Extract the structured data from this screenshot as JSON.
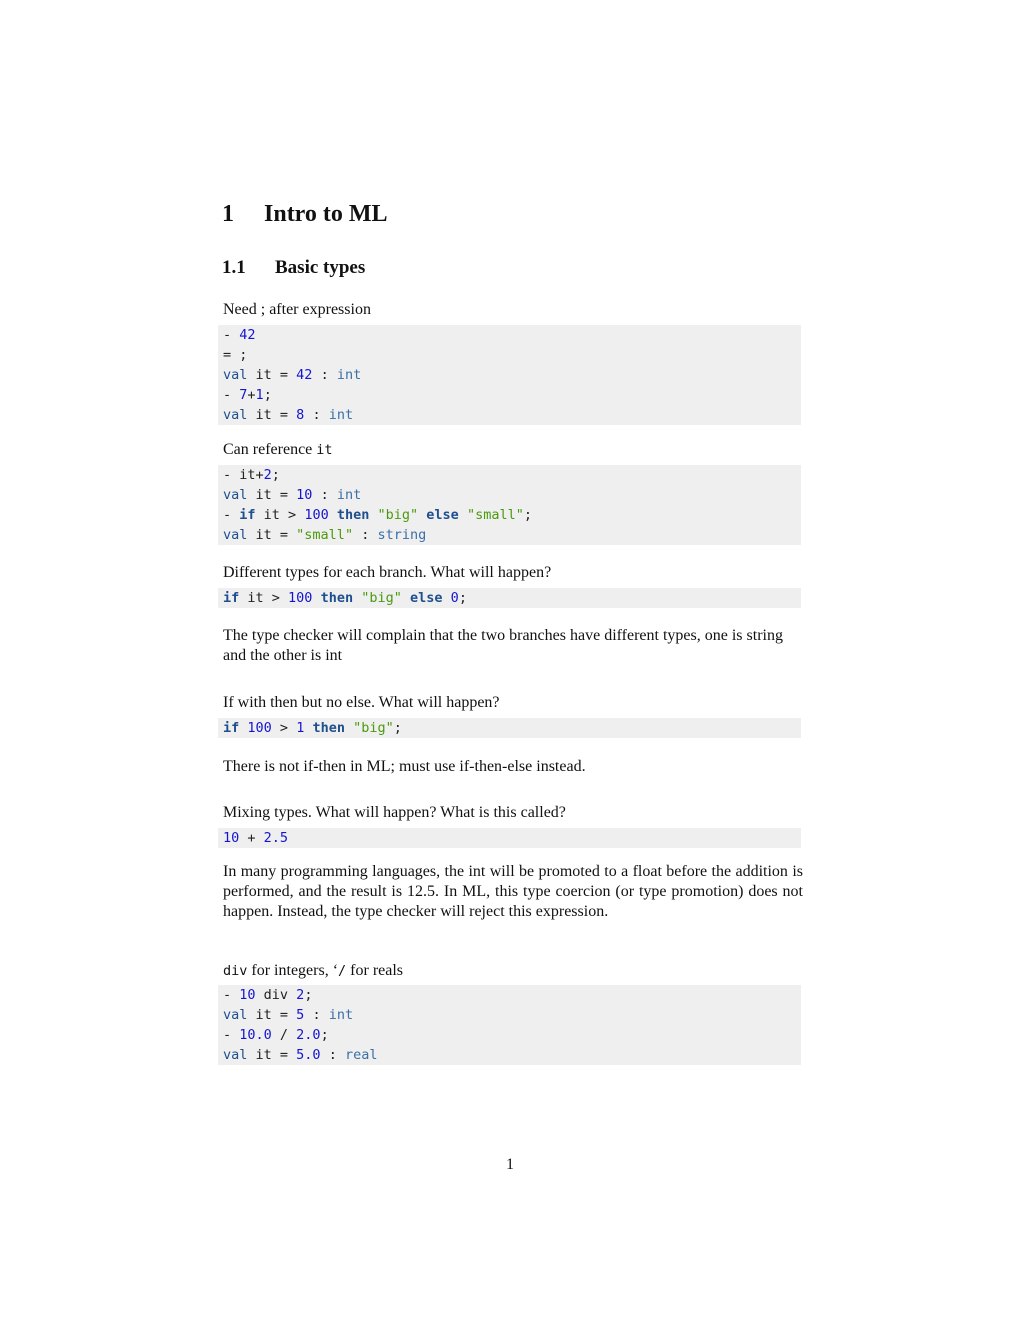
{
  "section": {
    "number": "1",
    "title": "Intro to ML"
  },
  "subsection": {
    "number": "1.1",
    "title": "Basic types"
  },
  "blocks": [
    {
      "caption": "Need ; after expression",
      "code": [
        [
          [
            "p",
            "- "
          ],
          [
            "n",
            "42"
          ]
        ],
        [
          [
            "p",
            "= ;"
          ]
        ],
        [
          [
            "val",
            "val"
          ],
          [
            "p",
            " it = "
          ],
          [
            "n",
            "42"
          ],
          [
            "p",
            " : "
          ],
          [
            "ty",
            "int"
          ]
        ],
        [
          [
            "p",
            "- "
          ],
          [
            "n",
            "7"
          ],
          [
            "p",
            "+"
          ],
          [
            "n",
            "1"
          ],
          [
            "p",
            ";"
          ]
        ],
        [
          [
            "val",
            "val"
          ],
          [
            "p",
            " it = "
          ],
          [
            "n",
            "8"
          ],
          [
            "p",
            " : "
          ],
          [
            "ty",
            "int"
          ]
        ]
      ]
    },
    {
      "caption_prefix": "Can reference ",
      "caption_code": "it",
      "code": [
        [
          [
            "p",
            "- it+"
          ],
          [
            "n",
            "2"
          ],
          [
            "p",
            ";"
          ]
        ],
        [
          [
            "val",
            "val"
          ],
          [
            "p",
            " it = "
          ],
          [
            "n",
            "10"
          ],
          [
            "p",
            " : "
          ],
          [
            "ty",
            "int"
          ]
        ],
        [
          [
            "p",
            "- "
          ],
          [
            "kw",
            "if"
          ],
          [
            "p",
            " it > "
          ],
          [
            "n",
            "100"
          ],
          [
            "p",
            " "
          ],
          [
            "kw",
            "then"
          ],
          [
            "p",
            " "
          ],
          [
            "s",
            "\"big\""
          ],
          [
            "p",
            " "
          ],
          [
            "kw",
            "else"
          ],
          [
            "p",
            " "
          ],
          [
            "s",
            "\"small\""
          ],
          [
            "p",
            ";"
          ]
        ],
        [
          [
            "val",
            "val"
          ],
          [
            "p",
            " it = "
          ],
          [
            "s",
            "\"small\""
          ],
          [
            "p",
            " : "
          ],
          [
            "ty",
            "string"
          ]
        ]
      ]
    },
    {
      "caption": "Different types for each branch. What will happen?",
      "code": [
        [
          [
            "kw",
            "if"
          ],
          [
            "p",
            " it > "
          ],
          [
            "n",
            "100"
          ],
          [
            "p",
            " "
          ],
          [
            "kw",
            "then"
          ],
          [
            "p",
            " "
          ],
          [
            "s",
            "\"big\""
          ],
          [
            "p",
            " "
          ],
          [
            "kw",
            "else"
          ],
          [
            "p",
            " "
          ],
          [
            "n",
            "0"
          ],
          [
            "p",
            ";"
          ]
        ]
      ],
      "answer": "The type checker will complain that the two branches have different types, one is string and the other is int"
    },
    {
      "caption": "If with then but no else. What will happen?",
      "code": [
        [
          [
            "kw",
            "if"
          ],
          [
            "p",
            " "
          ],
          [
            "n",
            "100"
          ],
          [
            "p",
            " > "
          ],
          [
            "n",
            "1"
          ],
          [
            "p",
            " "
          ],
          [
            "kw",
            "then"
          ],
          [
            "p",
            " "
          ],
          [
            "s",
            "\"big\""
          ],
          [
            "p",
            ";"
          ]
        ]
      ],
      "answer": "There is not if-then in ML; must use if-then-else instead."
    },
    {
      "caption": "Mixing types. What will happen? What is this called?",
      "code": [
        [
          [
            "n",
            "10"
          ],
          [
            "p",
            " + "
          ],
          [
            "n",
            "2.5"
          ]
        ]
      ],
      "answer": "In many programming languages, the int will be promoted to a float before the addition is performed, and the result is 12.5. In ML, this type coercion (or type promotion) does not happen. Instead, the type checker will reject this expression."
    },
    {
      "caption_code": "div",
      "caption_mid": " for integers, ‘",
      "caption_code2": "/",
      "caption_suffix": " for reals",
      "code": [
        [
          [
            "p",
            "- "
          ],
          [
            "n",
            "10"
          ],
          [
            "p",
            " div "
          ],
          [
            "n",
            "2"
          ],
          [
            "p",
            ";"
          ]
        ],
        [
          [
            "val",
            "val"
          ],
          [
            "p",
            " it = "
          ],
          [
            "n",
            "5"
          ],
          [
            "p",
            " : "
          ],
          [
            "ty",
            "int"
          ]
        ],
        [
          [
            "p",
            "- "
          ],
          [
            "n",
            "10.0"
          ],
          [
            "p",
            " / "
          ],
          [
            "n",
            "2.0"
          ],
          [
            "p",
            ";"
          ]
        ],
        [
          [
            "val",
            "val"
          ],
          [
            "p",
            " it = "
          ],
          [
            "n",
            "5.0"
          ],
          [
            "p",
            " : "
          ],
          [
            "ty",
            "real"
          ]
        ]
      ]
    }
  ],
  "page_number": "1"
}
